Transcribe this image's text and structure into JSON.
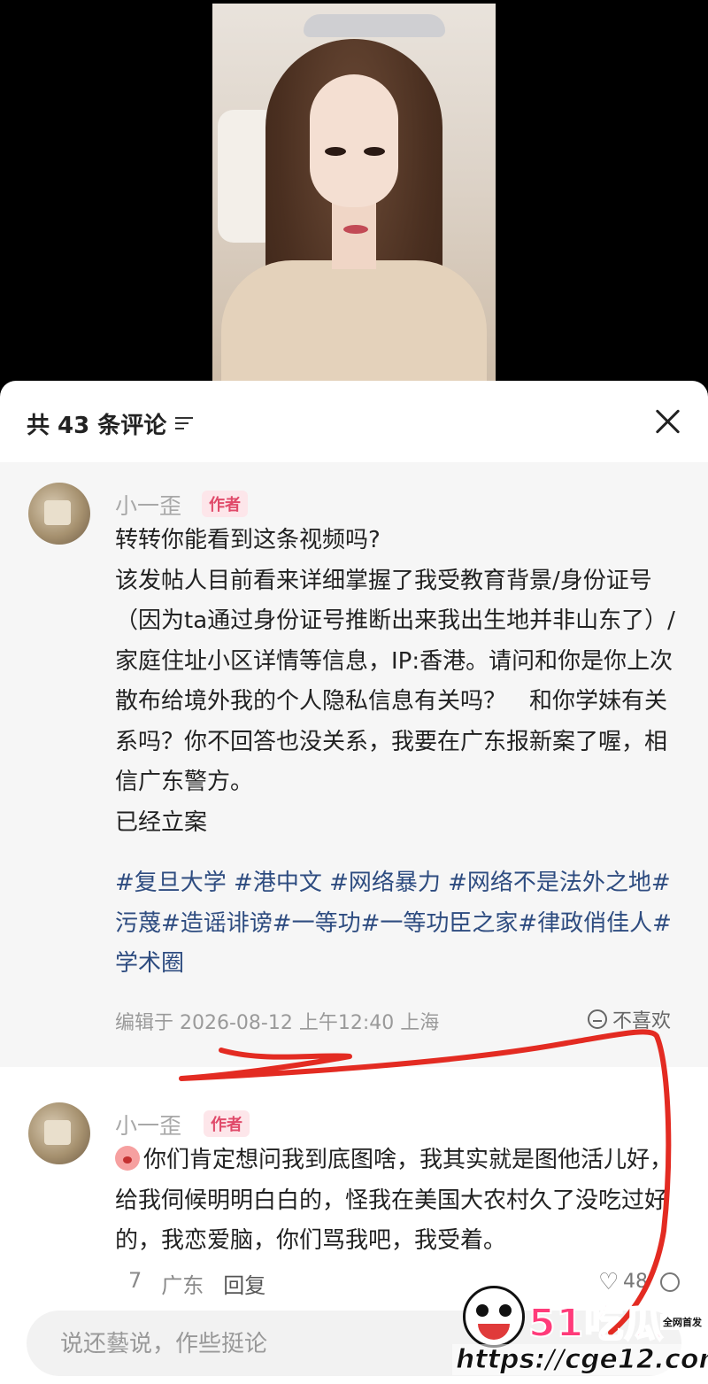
{
  "header": {
    "title": "共 43 条评论"
  },
  "comments": [
    {
      "username": "小一歪",
      "tag": "作者",
      "lines": [
        "转转你能看到这条视频吗?",
        "该发帖人目前看来详细掌握了我受教育背景/身份证号（因为ta通过身份证号推断出来我出生地并非山东了）/家庭住址小区详情等信息，IP:香港。请问和你是你上次散布给境外我的个人隐私信息有关吗？　和你学妹有关系吗？你不回答也没关系，我要在广东报新案了喔，相信广东警方。",
        "已经立案"
      ],
      "hashtags": "#复旦大学 #港中文 #网络暴力 #网络不是法外之地#污蔑#造谣诽谤#一等功#一等功臣之家#律政俏佳人#学术圈",
      "meta": "编辑于  2026-08-12 上午12:40 上海",
      "dislike_label": "不喜欢"
    },
    {
      "username": "小一歪",
      "tag": "作者",
      "text": "你们肯定想问我到底图啥，我其实就是图他活儿好，给我伺候明明白白的，怪我在美国大农村久了没吃过好的，我恋爱脑，你们骂我吧，我受着。",
      "time": "7",
      "location": "广东",
      "reply_label": "回复",
      "likes": "48"
    }
  ],
  "input": {
    "placeholder": "说还藝说，作些挺论"
  },
  "watermark": {
    "title": "51吃瓜",
    "badge": "全网首发",
    "url": "https://cge12.com"
  },
  "colors": {
    "author_tag": "#e04a6a",
    "hashtag": "#2e4c80",
    "annotation": "#e32b22"
  }
}
